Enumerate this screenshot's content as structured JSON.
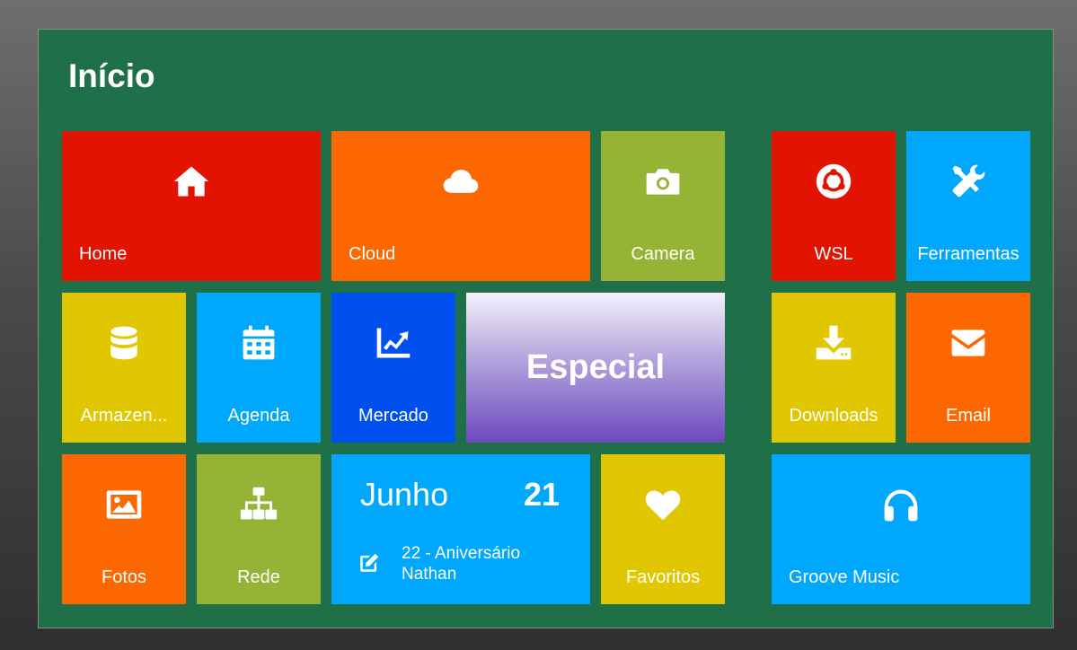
{
  "page": {
    "title": "Início"
  },
  "tiles": {
    "home": {
      "label": "Home",
      "icon": "home-icon"
    },
    "cloud": {
      "label": "Cloud",
      "icon": "cloud-icon"
    },
    "camera": {
      "label": "Camera",
      "icon": "camera-icon"
    },
    "wsl": {
      "label": "WSL",
      "icon": "ubuntu-icon"
    },
    "ferramentas": {
      "label": "Ferramentas",
      "icon": "tools-icon"
    },
    "armazenamento": {
      "label": "Armazen...",
      "icon": "database-icon"
    },
    "agenda": {
      "label": "Agenda",
      "icon": "calendar-icon"
    },
    "mercado": {
      "label": "Mercado",
      "icon": "chart-line-icon"
    },
    "especial": {
      "label": "Especial"
    },
    "downloads": {
      "label": "Downloads",
      "icon": "download-icon"
    },
    "email": {
      "label": "Email",
      "icon": "envelope-icon"
    },
    "fotos": {
      "label": "Fotos",
      "icon": "image-icon"
    },
    "rede": {
      "label": "Rede",
      "icon": "sitemap-icon"
    },
    "calendario": {
      "month": "Junho",
      "day": "21",
      "event_line1": "22 - Aniversário",
      "event_line2": "Nathan",
      "icon": "edit-icon"
    },
    "favoritos": {
      "label": "Favoritos",
      "icon": "heart-icon"
    },
    "groove": {
      "label": "Groove Music",
      "icon": "headphones-icon"
    }
  },
  "colors": {
    "background_panel": "#1f7048",
    "red": "#e31301",
    "orange": "#fd6700",
    "olive": "#95b334",
    "yellow": "#e1c701",
    "sky": "#00a8fd",
    "blue": "#0050ef",
    "purple": "#6d49bf"
  }
}
